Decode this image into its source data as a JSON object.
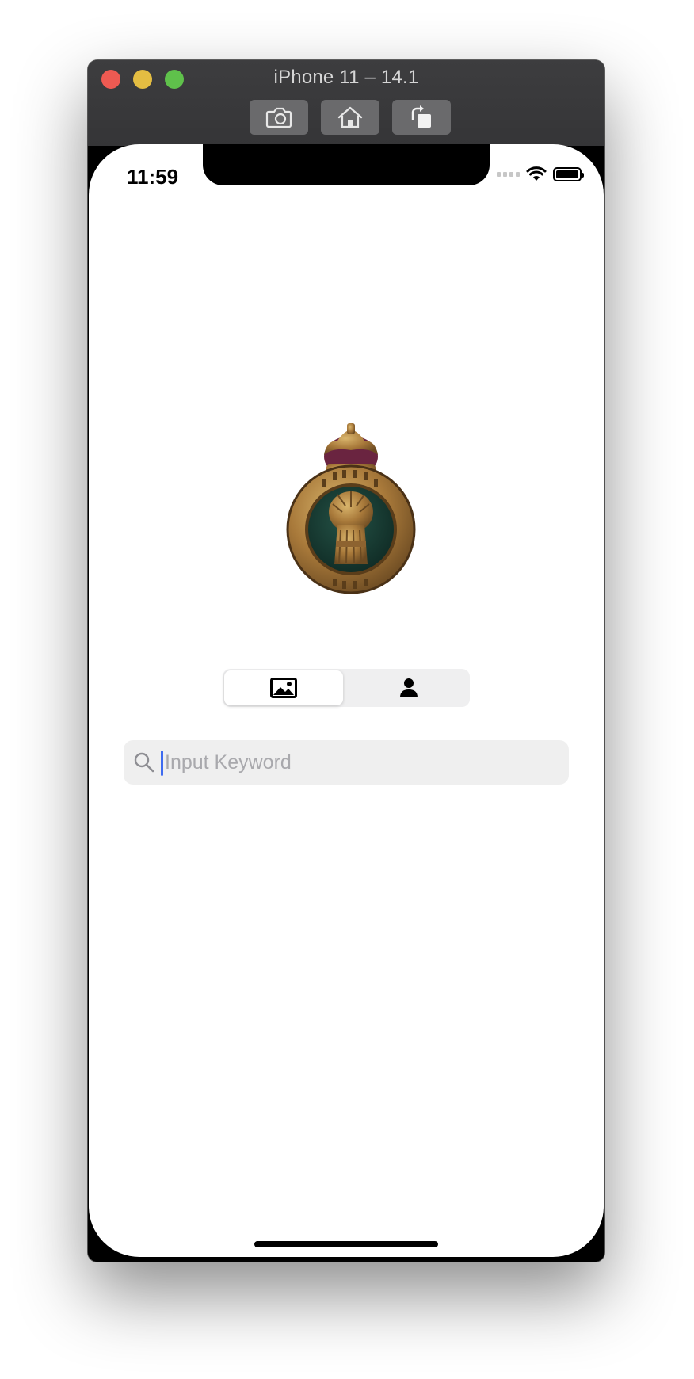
{
  "window": {
    "title": "iPhone 11 – 14.1",
    "toolbar": [
      {
        "icon": "screenshot-icon"
      },
      {
        "icon": "home-icon"
      },
      {
        "icon": "rotate-icon"
      }
    ]
  },
  "status_bar": {
    "time": "11:59",
    "icons": [
      "signal-icon",
      "wifi-icon",
      "battery-icon"
    ]
  },
  "badge": {
    "icon": "regimental-badge-image"
  },
  "segmented_control": {
    "segments": [
      {
        "icon": "image-icon",
        "selected": true
      },
      {
        "icon": "person-icon",
        "selected": false
      }
    ]
  },
  "search": {
    "placeholder": "Input Keyword",
    "value": ""
  },
  "colors": {
    "cursor": "#3e6bf0",
    "search_bg": "#efefef",
    "segment_bg": "#efeff0"
  }
}
